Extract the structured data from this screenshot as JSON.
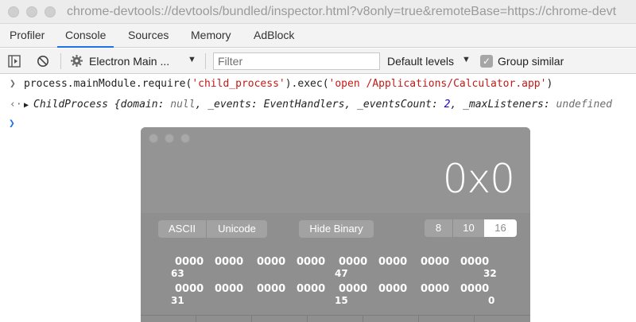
{
  "window": {
    "url": "chrome-devtools://devtools/bundled/inspector.html?v8only=true&remoteBase=https://chrome-devt"
  },
  "tabs": [
    {
      "label": "Profiler"
    },
    {
      "label": "Console",
      "active": true
    },
    {
      "label": "Sources"
    },
    {
      "label": "Memory"
    },
    {
      "label": "AdBlock"
    }
  ],
  "toolbar": {
    "context": "Electron Main ...",
    "filter_placeholder": "Filter",
    "levels": "Default levels",
    "group_similar": "Group similar",
    "group_similar_checked": true
  },
  "console": {
    "input_line": {
      "prefix": "process.mainModule.require(",
      "arg1": "'child_process'",
      "middle": ").exec(",
      "arg2": "'open /Applications/Calculator.app'",
      "suffix": ")"
    },
    "output_line": {
      "class_name": "ChildProcess",
      "open": " {",
      "k1": "domain",
      "v1": "null",
      "k2": "_events",
      "v2": "EventHandlers",
      "k3": "_eventsCount",
      "v3": "2",
      "k4": "_maxListeners",
      "v4": "undefined"
    }
  },
  "calculator": {
    "display": "0x0",
    "encoding_buttons": [
      "ASCII",
      "Unicode"
    ],
    "binary_button": "Hide Binary",
    "base_buttons": [
      "8",
      "10",
      "16"
    ],
    "selected_base": "16",
    "bit_rows": [
      {
        "groups": [
          "0000",
          "0000",
          "0000",
          "0000",
          "0000",
          "0000",
          "0000",
          "0000"
        ],
        "labels": [
          "63",
          "47",
          "32"
        ]
      },
      {
        "groups": [
          "0000",
          "0000",
          "0000",
          "0000",
          "0000",
          "0000",
          "0000",
          "0000"
        ],
        "labels": [
          "31",
          "15",
          "0"
        ]
      }
    ]
  }
}
